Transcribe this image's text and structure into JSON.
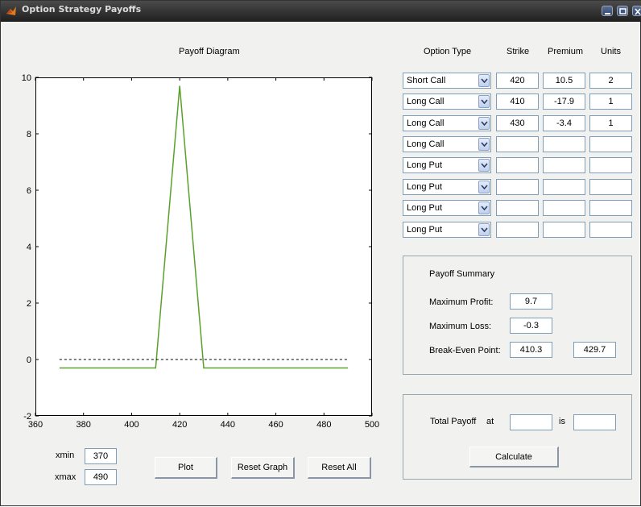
{
  "window": {
    "title": "Option Strategy Payoffs"
  },
  "plot": {
    "title": "Payoff Diagram"
  },
  "chart_data": {
    "type": "line",
    "title": "Payoff Diagram",
    "xlim": [
      360,
      500
    ],
    "ylim": [
      -2,
      10
    ],
    "xticks": [
      360,
      380,
      400,
      420,
      440,
      460,
      480,
      500
    ],
    "yticks": [
      -2,
      0,
      2,
      4,
      6,
      8,
      10
    ],
    "series": [
      {
        "x": [
          370,
          410,
          420,
          430,
          490
        ],
        "y": [
          -0.3,
          -0.3,
          9.7,
          -0.3,
          -0.3
        ],
        "color": "#5aa02c",
        "style": "solid"
      },
      {
        "x": [
          370,
          490
        ],
        "y": [
          0,
          0
        ],
        "color": "#000000",
        "style": "dashed"
      }
    ]
  },
  "range": {
    "xmin_label": "xmin",
    "xmin_value": "370",
    "xmax_label": "xmax",
    "xmax_value": "490"
  },
  "buttons": {
    "plot": "Plot",
    "reset_graph": "Reset Graph",
    "reset_all": "Reset All",
    "calculate": "Calculate"
  },
  "headers": {
    "option_type": "Option Type",
    "strike": "Strike",
    "premium": "Premium",
    "units": "Units"
  },
  "rows": [
    {
      "type": "Short Call",
      "strike": "420",
      "premium": "10.5",
      "units": "2"
    },
    {
      "type": "Long Call",
      "strike": "410",
      "premium": "-17.9",
      "units": "1"
    },
    {
      "type": "Long Call",
      "strike": "430",
      "premium": "-3.4",
      "units": "1"
    },
    {
      "type": "Long Call",
      "strike": "",
      "premium": "",
      "units": ""
    },
    {
      "type": "Long Put",
      "strike": "",
      "premium": "",
      "units": ""
    },
    {
      "type": "Long Put",
      "strike": "",
      "premium": "",
      "units": ""
    },
    {
      "type": "Long Put",
      "strike": "",
      "premium": "",
      "units": ""
    },
    {
      "type": "Long Put",
      "strike": "",
      "premium": "",
      "units": ""
    }
  ],
  "summary": {
    "title": "Payoff Summary",
    "max_profit_label": "Maximum Profit:",
    "max_profit": "9.7",
    "max_loss_label": "Maximum Loss:",
    "max_loss": "-0.3",
    "break_even_label": "Break-Even Point:",
    "break_even_1": "410.3",
    "break_even_2": "429.7"
  },
  "total": {
    "label": "Total Payoff",
    "at_label": "at",
    "at_value": "",
    "is_label": "is",
    "is_value": ""
  }
}
